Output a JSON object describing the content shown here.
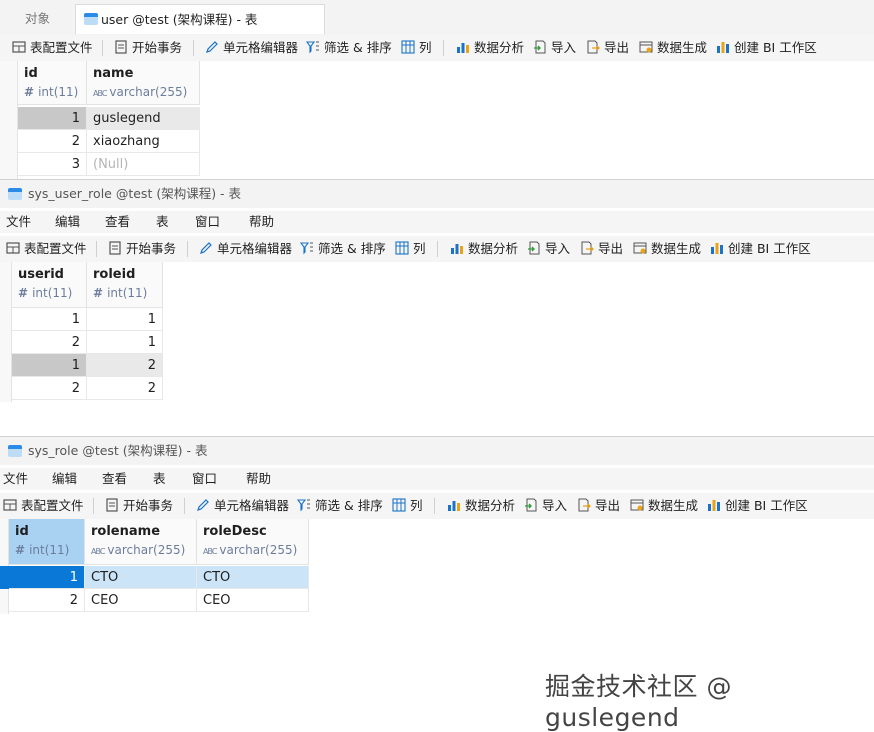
{
  "tabs": [
    {
      "label": "对象",
      "active": false
    },
    {
      "label": "user @test (架构课程) - 表",
      "active": true
    }
  ],
  "toolbar": {
    "table_config": "表配置文件",
    "begin_transaction": "开始事务",
    "cell_editor": "单元格编辑器",
    "filter_sort": "筛选 & 排序",
    "columns": "列",
    "data_analysis": "数据分析",
    "import": "导入",
    "export": "导出",
    "data_generation": "数据生成",
    "create_bi": "创建 BI 工作区"
  },
  "menu": {
    "file": "文件",
    "edit": "编辑",
    "view": "查看",
    "table": "表",
    "window": "窗口",
    "help": "帮助"
  },
  "user_table": {
    "columns": [
      {
        "name": "id",
        "type": "int(11)",
        "type_icon": "hash"
      },
      {
        "name": "name",
        "type": "varchar(255)",
        "type_icon": "abc"
      }
    ],
    "rows": [
      {
        "id": "1",
        "name": "guslegend"
      },
      {
        "id": "2",
        "name": "xiaozhang"
      },
      {
        "id": "3",
        "name": "(Null)"
      }
    ]
  },
  "sys_user_role": {
    "title": "sys_user_role @test (架构课程) - 表",
    "columns": [
      {
        "name": "userid",
        "type": "int(11)"
      },
      {
        "name": "roleid",
        "type": "int(11)"
      }
    ],
    "rows": [
      {
        "userid": "1",
        "roleid": "1"
      },
      {
        "userid": "2",
        "roleid": "1"
      },
      {
        "userid": "1",
        "roleid": "2"
      },
      {
        "userid": "2",
        "roleid": "2"
      }
    ]
  },
  "sys_role": {
    "title": "sys_role @test (架构课程) - 表",
    "columns": [
      {
        "name": "id",
        "type": "int(11)"
      },
      {
        "name": "rolename",
        "type": "varchar(255)"
      },
      {
        "name": "roleDesc",
        "type": "varchar(255)"
      }
    ],
    "rows": [
      {
        "id": "1",
        "rolename": "CTO",
        "roleDesc": "CTO"
      },
      {
        "id": "2",
        "rolename": "CEO",
        "roleDesc": "CEO"
      }
    ]
  },
  "watermark": "掘金技术社区 @ guslegend",
  "colors": {
    "selected_row": "#cce4f7",
    "selected_cell": "#0a78d7",
    "selected_header": "#a8d1f2",
    "active_grey": "#c8c8c8"
  }
}
